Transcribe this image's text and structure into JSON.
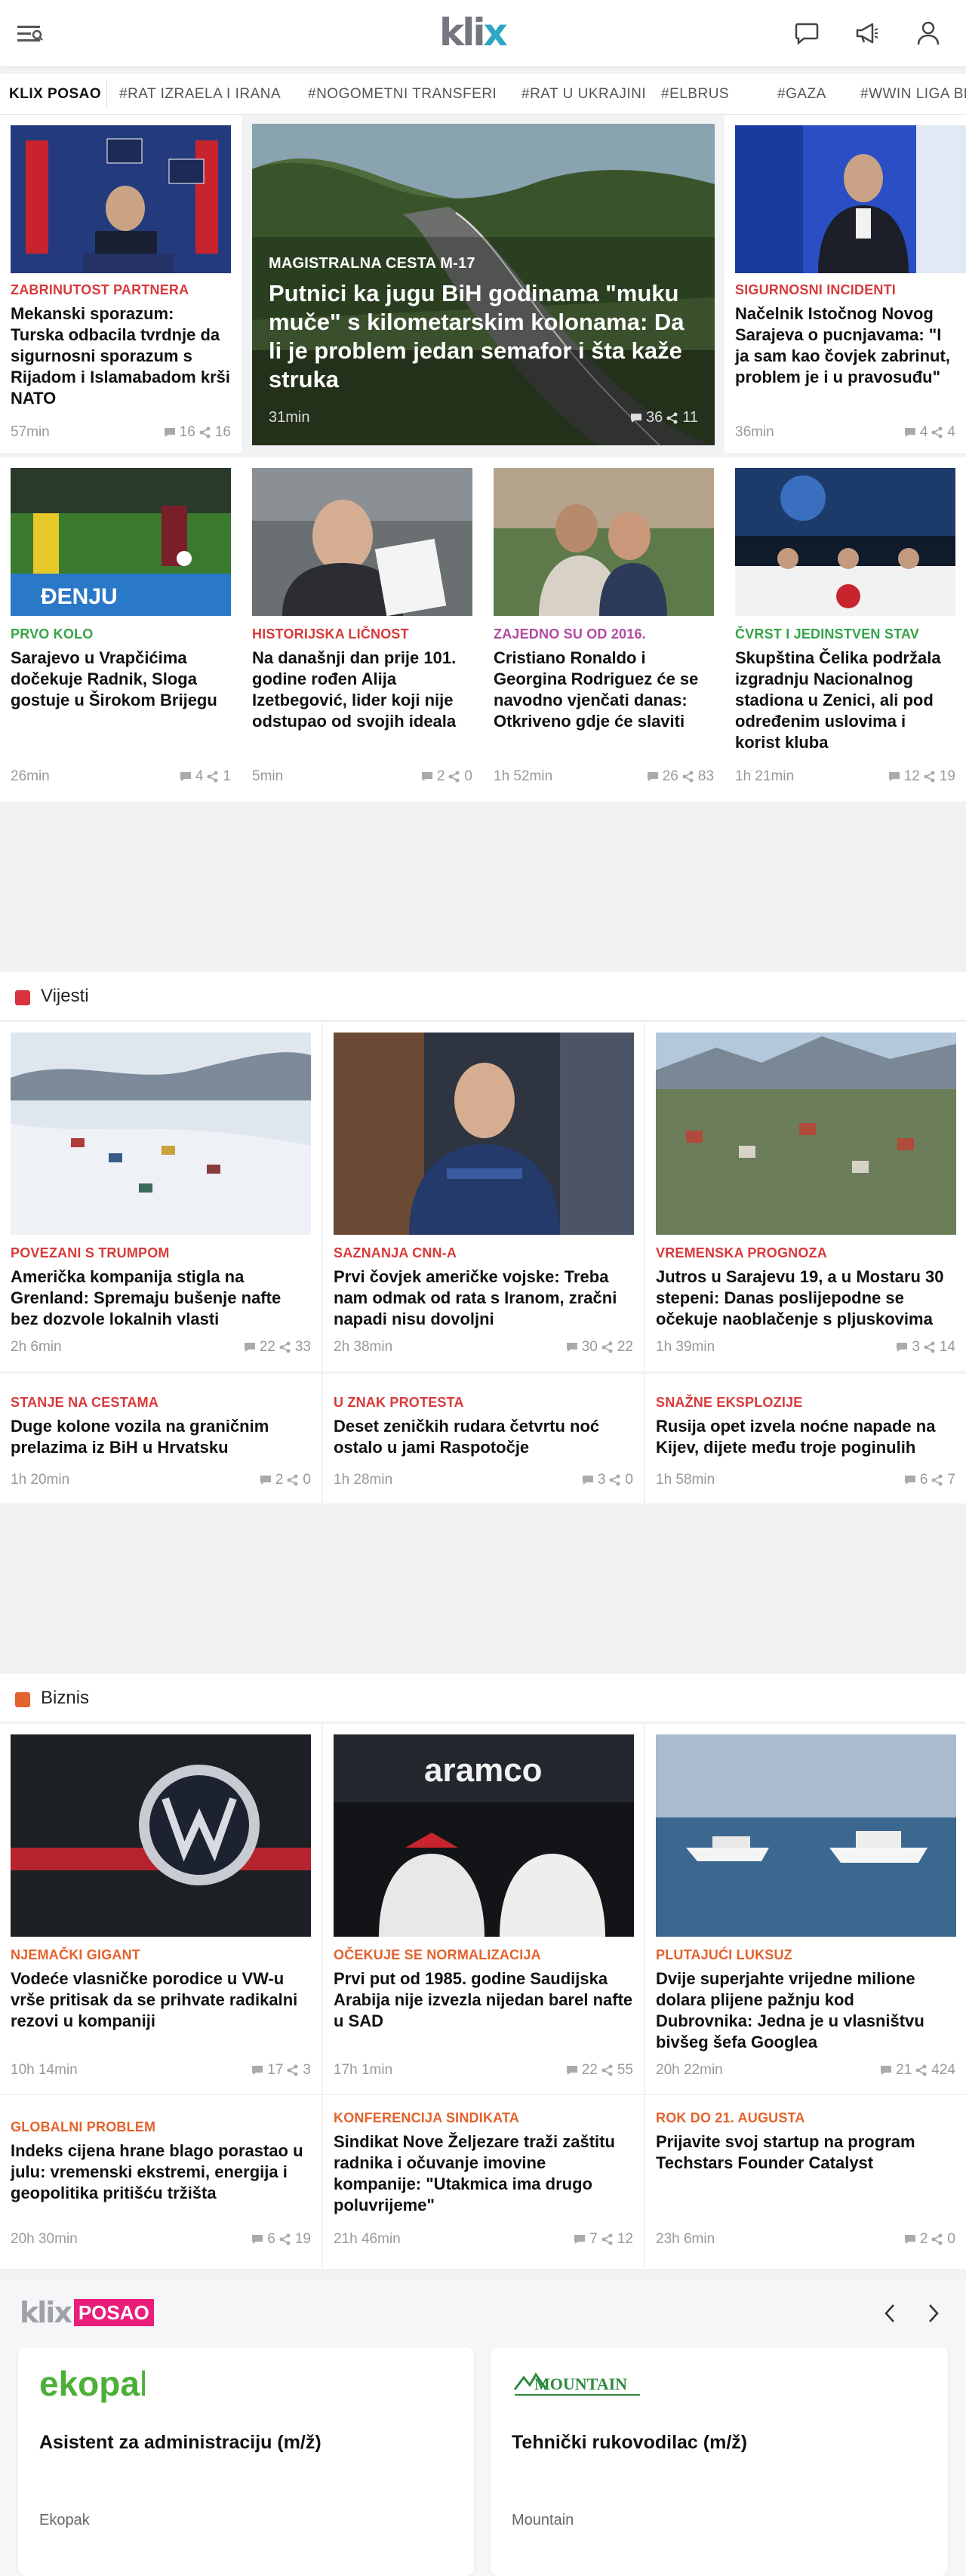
{
  "header": {
    "logo_text_a": "kli",
    "logo_text_b": "x",
    "icons": [
      "menu-icon",
      "chat-icon",
      "megaphone-icon",
      "user-icon"
    ]
  },
  "tags": [
    "KLIX POSAO",
    "#RAT IZRAELA I IRANA",
    "#NOGOMETNI TRANSFERI",
    "#RAT U UKRAJINI",
    "#ELBRUS",
    "#GAZA",
    "#WWIN LIGA BH"
  ],
  "top": {
    "hero": {
      "category": "MAGISTRALNA CESTA M-17",
      "title": "Putnici ka jugu BiH godinama \"muku muče\" s kilometarskim kolonama: Da li je problem jedan semafor i šta kaže struka",
      "time": "31min",
      "comments": "36",
      "shares": "11"
    },
    "cards": [
      {
        "category": "ZABRINUTOST PARTNERA",
        "title": "Mekanski sporazum: Turska odbacila tvrdnje da sigurnosni sporazum s Rijadom i Islamabadom krši NATO",
        "time": "57min",
        "comments": "16",
        "shares": "16",
        "color": "#d83a3a"
      },
      {
        "category": "SIGURNOSNI INCIDENTI",
        "title": "Načelnik Istočnog Novog Sarajeva o pucnjavama: \"I ja sam kao čovjek zabrinut, problem je i u pravosuđu\"",
        "time": "36min",
        "comments": "4",
        "shares": "4",
        "color": "#d83a3a"
      },
      {
        "category": "PRVO KOLO",
        "title": "Sarajevo u Vrapčićima dočekuje Radnik, Sloga gostuje u Širokom Brijegu",
        "time": "26min",
        "comments": "4",
        "shares": "1",
        "color": "#35a447"
      },
      {
        "category": "HISTORIJSKA LIČNOST",
        "title": "Na današnji dan prije 101. godine rođen Alija Izetbegović, lider koji nije odstupao od svojih ideala",
        "time": "5min",
        "comments": "2",
        "shares": "0",
        "color": "#d83a3a"
      },
      {
        "category": "ZAJEDNO SU OD 2016.",
        "title": "Cristiano Ronaldo i Georgina Rodriguez će se navodno vjenčati danas: Otkriveno gdje će slaviti",
        "time": "1h 52min",
        "comments": "26",
        "shares": "83",
        "color": "#b14a9e"
      },
      {
        "category": "ČVRST I JEDINSTVEN STAV",
        "title": "Skupština Čelika podržala izgradnju Nacionalnog stadiona u Zenici, ali pod određenim uslovima i korist kluba",
        "time": "1h 21min",
        "comments": "12",
        "shares": "19",
        "color": "#35a447"
      }
    ]
  },
  "vijesti": {
    "label": "Vijesti",
    "color": "#d8323c",
    "cards": [
      {
        "category": "POVEZANI S TRUMPOM",
        "title": "Američka kompanija stigla na Grenland: Spremaju bušenje nafte bez dozvole lokalnih vlasti",
        "time": "2h 6min",
        "comments": "22",
        "shares": "33"
      },
      {
        "category": "SAZNANJA CNN-A",
        "title": "Prvi čovjek američke vojske: Treba nam odmak od rata s Iranom, zračni napadi nisu dovoljni",
        "time": "2h 38min",
        "comments": "30",
        "shares": "22"
      },
      {
        "category": "VREMENSKA PROGNOZA",
        "title": "Jutros u Sarajevu 19, a u Mostaru 30 stepeni: Danas poslijepodne se očekuje naoblačenje s pljuskovima",
        "time": "1h 39min",
        "comments": "3",
        "shares": "14"
      },
      {
        "category": "STANJE NA CESTAMA",
        "title": "Duge kolone vozila na graničnim prelazima iz BiH u Hrvatsku",
        "time": "1h 20min",
        "comments": "2",
        "shares": "0"
      },
      {
        "category": "U ZNAK PROTESTA",
        "title": "Deset zeničkih rudara četvrtu noć ostalo u jami Raspotočje",
        "time": "1h 28min",
        "comments": "3",
        "shares": "0"
      },
      {
        "category": "SNAŽNE EKSPLOZIJE",
        "title": "Rusija opet izvela noćne napade na Kijev, dijete među troje poginulih",
        "time": "1h 58min",
        "comments": "6",
        "shares": "7"
      }
    ]
  },
  "biznis": {
    "label": "Biznis",
    "color": "#e4622c",
    "cards": [
      {
        "category": "NJEMAČKI GIGANT",
        "title": "Vodeće vlasničke porodice u VW-u vrše pritisak da se prihvate radikalni rezovi u kompaniji",
        "time": "10h 14min",
        "comments": "17",
        "shares": "3"
      },
      {
        "category": "OČEKUJE SE NORMALIZACIJA",
        "title": "Prvi put od 1985. godine Saudijska Arabija nije izvezla nijedan barel nafte u SAD",
        "time": "17h 1min",
        "comments": "22",
        "shares": "55"
      },
      {
        "category": "PLUTAJUĆI LUKSUZ",
        "title": "Dvije superjahte vrijedne milione dolara plijene pažnju kod Dubrovnika: Jedna je u vlasništvu bivšeg šefa Googlea",
        "time": "20h 22min",
        "comments": "21",
        "shares": "424"
      },
      {
        "category": "GLOBALNI PROBLEM",
        "title": "Indeks cijena hrane blago porastao u julu: vremenski ekstremi, energija i geopolitika pritišću tržišta",
        "time": "20h 30min",
        "comments": "6",
        "shares": "19"
      },
      {
        "category": "KONFERENCIJA SINDIKATA",
        "title": "Sindikat Nove Željezare traži zaštitu radnika i očuvanje imovine kompanije: \"Utakmica ima drugo poluvrijeme\"",
        "time": "21h 46min",
        "comments": "7",
        "shares": "12"
      },
      {
        "category": "ROK DO 21. AUGUSTA",
        "title": "Prijavite svoj startup na program Techstars Founder Catalyst",
        "time": "23h 6min",
        "comments": "2",
        "shares": "0"
      }
    ]
  },
  "posao": {
    "logo_klix": "klix",
    "logo_posao": "POSAO",
    "jobs": [
      {
        "logo": "ekopak",
        "title": "Asistent za administraciju (m/ž)",
        "company": "Ekopak"
      },
      {
        "logo": "MOUNTAIN",
        "title": "Tehnički rukovodilac (m/ž)",
        "company": "Mountain"
      }
    ]
  }
}
